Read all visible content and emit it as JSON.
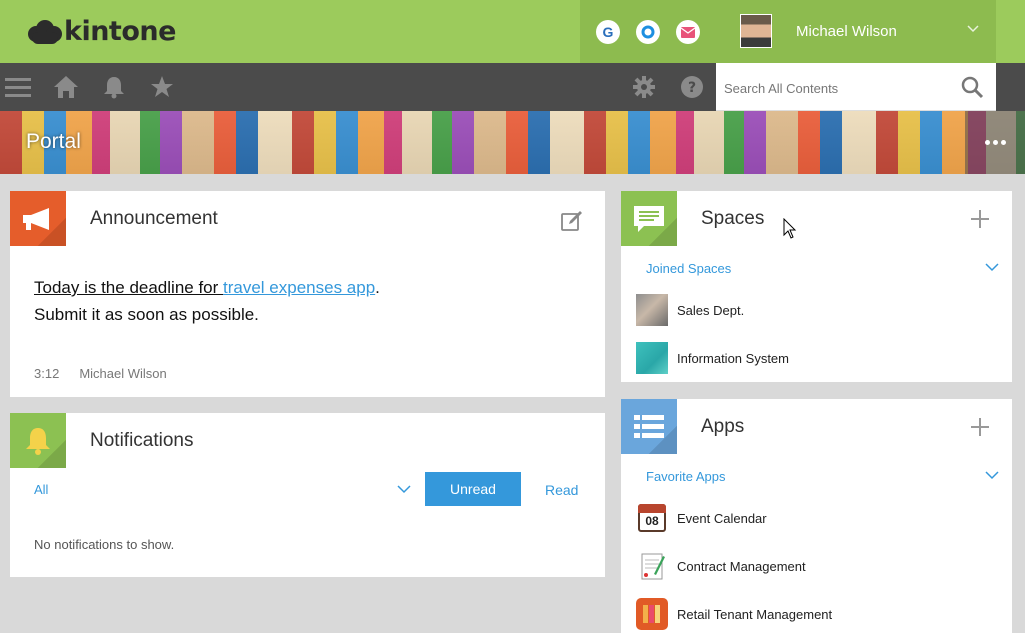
{
  "app": {
    "logo_text": "kintone"
  },
  "header": {
    "services": [
      {
        "icon": "g-service-icon",
        "letter": "G",
        "color": "#2a6ebb"
      },
      {
        "icon": "o-service-icon",
        "color": "#1d8fe0"
      },
      {
        "icon": "mail-icon",
        "color": "#e8537a"
      }
    ],
    "user_name": "Michael Wilson"
  },
  "search": {
    "placeholder": "Search All Contents"
  },
  "banner": {
    "title": "Portal"
  },
  "announcement": {
    "title": "Announcement",
    "line1_prefix": "Today is the deadline for ",
    "line1_link": "travel expenses app",
    "line1_suffix": ".",
    "line2": "Submit it as soon as possible.",
    "time": "3:12",
    "author": "Michael Wilson"
  },
  "notifications": {
    "title": "Notifications",
    "filter": "All",
    "unread_label": "Unread",
    "read_label": "Read",
    "empty_message": "No notifications to show."
  },
  "spaces": {
    "title": "Spaces",
    "group_label": "Joined Spaces",
    "items": [
      {
        "label": "Sales Dept."
      },
      {
        "label": "Information System"
      }
    ]
  },
  "apps": {
    "title": "Apps",
    "group_label": "Favorite Apps",
    "items": [
      {
        "label": "Event Calendar",
        "icon_text": "08"
      },
      {
        "label": "Contract Management"
      },
      {
        "label": "Retail Tenant Management"
      }
    ]
  },
  "colors": {
    "header_green": "#9ccb5c",
    "nav_dark": "#4b4b4b",
    "accent_blue": "#3498db",
    "announcement_orange": "#e55d2b",
    "notification_green": "#8cc152",
    "spaces_green": "#8cc152",
    "apps_blue": "#6aa6dc"
  }
}
